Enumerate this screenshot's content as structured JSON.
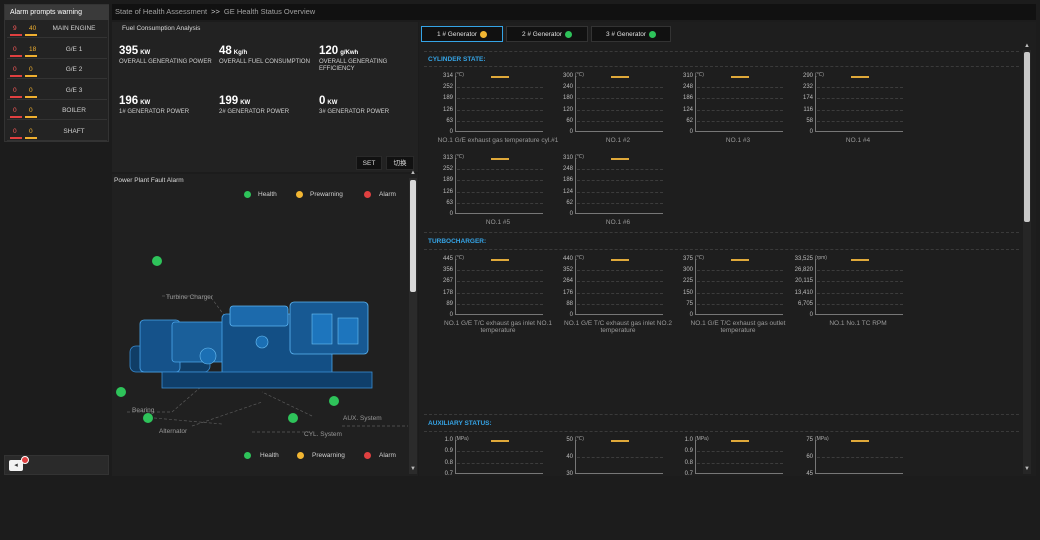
{
  "alarm": {
    "title": "Alarm prompts warning",
    "rows": [
      {
        "alarm": "9",
        "prewarn": "40",
        "name": "MAIN ENGINE"
      },
      {
        "alarm": "0",
        "prewarn": "18",
        "name": "G/E 1"
      },
      {
        "alarm": "0",
        "prewarn": "0",
        "name": "G/E 2"
      },
      {
        "alarm": "0",
        "prewarn": "0",
        "name": "G/E 3"
      },
      {
        "alarm": "0",
        "prewarn": "0",
        "name": "BOILER"
      },
      {
        "alarm": "0",
        "prewarn": "0",
        "name": "SHAFT"
      }
    ]
  },
  "breadcrumb": {
    "root": "State of Health Assessment",
    "sep": ">>",
    "current": "GE Health Status Overview"
  },
  "fuel": {
    "title": "Fuel Consumption Analysis",
    "metrics": [
      {
        "value": "395",
        "unit": "KW",
        "label": "OVERALL GENERATING POWER"
      },
      {
        "value": "48",
        "unit": "Kg/h",
        "label": "OVERALL FUEL CONSUMPTION"
      },
      {
        "value": "120",
        "unit": "g/Kwh",
        "label": "OVERALL GENERATING EFFICIENCY"
      },
      {
        "value": "196",
        "unit": "KW",
        "label": "1# GENERATOR POWER"
      },
      {
        "value": "199",
        "unit": "KW",
        "label": "2# GENERATOR POWER"
      },
      {
        "value": "0",
        "unit": "KW",
        "label": "3# GENERATOR POWER"
      }
    ],
    "btn_set": "SET",
    "btn_switch": "切换"
  },
  "fault": {
    "title": "Power Plant Fault Alarm",
    "legend": {
      "health": "Health",
      "prewarning": "Prewarning",
      "alarm": "Alarm"
    },
    "labels": {
      "turbo": "Turbine Charger",
      "bearing": "Bearing",
      "alternator": "Alternator",
      "cyl": "CYL. System",
      "aux": "AUX. System"
    }
  },
  "tabs": [
    {
      "label": "1 # Generator",
      "status": "#f2b632"
    },
    {
      "label": "2 # Generator",
      "status": "#2ec35a"
    },
    {
      "label": "3 # Generator",
      "status": "#2ec35a"
    }
  ],
  "sections": {
    "cylinder": "CYLINDER STATE:",
    "turbo": "TURBOCHARGER:",
    "aux": "AUXILIARY STATUS:"
  },
  "colors": {
    "health": "#2ec35a",
    "prewarning": "#f2b632",
    "alarm": "#e04040",
    "accent": "#35a4e6"
  },
  "charts": {
    "cyl": [
      {
        "unit": "(℃)",
        "ticks": [
          "314",
          "252",
          "189",
          "126",
          "63",
          "0"
        ],
        "caption": "NO.1 G/E exhaust gas temperature cyl.#1"
      },
      {
        "unit": "(℃)",
        "ticks": [
          "300",
          "240",
          "180",
          "120",
          "60",
          "0"
        ],
        "caption": "NO.1 #2"
      },
      {
        "unit": "(℃)",
        "ticks": [
          "310",
          "248",
          "186",
          "124",
          "62",
          "0"
        ],
        "caption": "NO.1 #3"
      },
      {
        "unit": "(℃)",
        "ticks": [
          "290",
          "232",
          "174",
          "116",
          "58",
          "0"
        ],
        "caption": "NO.1 #4"
      },
      {
        "unit": "(℃)",
        "ticks": [
          "313",
          "252",
          "189",
          "126",
          "63",
          "0"
        ],
        "caption": "NO.1 #5"
      },
      {
        "unit": "(℃)",
        "ticks": [
          "310",
          "248",
          "186",
          "124",
          "62",
          "0"
        ],
        "caption": "NO.1 #6"
      }
    ],
    "turbo": [
      {
        "unit": "(℃)",
        "ticks": [
          "445",
          "356",
          "267",
          "178",
          "89",
          "0"
        ],
        "caption": "NO.1 G/E T/C exhaust gas inlet NO.1 temperature"
      },
      {
        "unit": "(℃)",
        "ticks": [
          "440",
          "352",
          "264",
          "176",
          "88",
          "0"
        ],
        "caption": "NO.1 G/E T/C exhaust gas inlet NO.2 temperature"
      },
      {
        "unit": "(℃)",
        "ticks": [
          "375",
          "300",
          "225",
          "150",
          "75",
          "0"
        ],
        "caption": "NO.1 G/E T/C exhaust gas outlet temperature"
      },
      {
        "unit": "(rpm)",
        "ticks": [
          "33,525",
          "26,820",
          "20,115",
          "13,410",
          "6,705",
          "0"
        ],
        "caption": "NO.1 No.1 TC RPM"
      }
    ],
    "aux": [
      {
        "unit": "(MPa)",
        "ticks": [
          "1.0",
          "0.9",
          "0.8",
          "0.7"
        ]
      },
      {
        "unit": "(℃)",
        "ticks": [
          "50",
          "40",
          "30"
        ]
      },
      {
        "unit": "(MPa)",
        "ticks": [
          "1.0",
          "0.9",
          "0.8",
          "0.7"
        ]
      },
      {
        "unit": "(MPa)",
        "ticks": [
          "75",
          "60",
          "45"
        ]
      }
    ]
  }
}
